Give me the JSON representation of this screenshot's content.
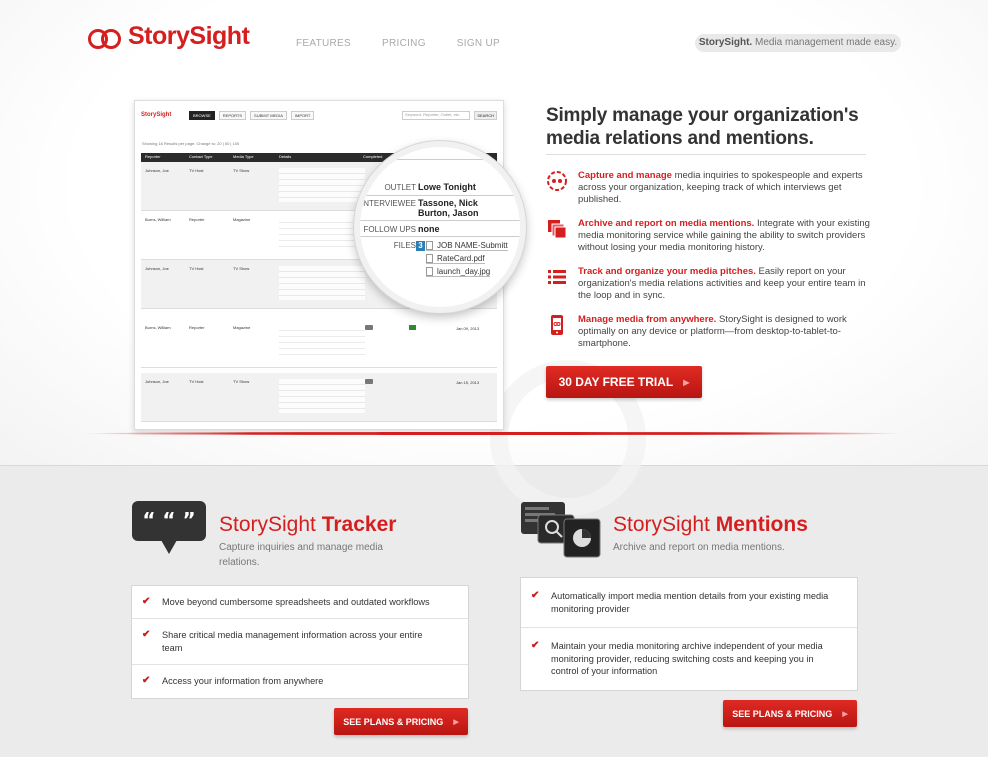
{
  "brand": {
    "name": "StorySight",
    "color": "#d51f1f"
  },
  "nav": {
    "items": [
      "Features",
      "Pricing",
      "Sign Up"
    ]
  },
  "tagline": {
    "bold": "StorySight.",
    "text": " Media management made easy."
  },
  "app_preview": {
    "logo": "StorySight",
    "buttons": [
      "BROWSE",
      "REPORTS",
      "SUBMIT MEDIA",
      "IMPORT"
    ],
    "search_placeholder": "Keyword, Reporter, Outlet, etc.",
    "search_button": "SEARCH",
    "results_text": "Showing 16 Results per page. Change to: 20 | 50 | 100",
    "columns": [
      "Reporter",
      "Contact Type",
      "Media Type",
      "Details",
      "Completed"
    ],
    "rows": [
      {
        "reporter": "Johnson, Joe",
        "contact": "TV Host",
        "media": "TV Show",
        "date": ""
      },
      {
        "reporter": "Burns, William",
        "contact": "Reporter",
        "media": "Magazine",
        "date": ""
      },
      {
        "reporter": "Johnson, Joe",
        "contact": "TV Host",
        "media": "TV Show",
        "date": ""
      },
      {
        "reporter": "Burns, William",
        "contact": "Reporter",
        "media": "Magazine",
        "date": "Jan 09, 2013"
      },
      {
        "reporter": "Johnson, Joe",
        "contact": "TV Host",
        "media": "TV Show",
        "date": "Jan 15, 2013"
      }
    ],
    "lens": {
      "outlet_label": "OUTLET",
      "outlet_value": "Lowe Tonight",
      "interviewee_label": "INTERVIEWEE",
      "interviewee_value_1": "Tassone, Nick",
      "interviewee_value_2": "Burton, Jason",
      "followups_label": "FOLLOW UPS",
      "followups_value": "none",
      "files_label": "FILES",
      "files_count": "3",
      "files": [
        "JOB NAME-Submitt",
        "RateCard.pdf",
        "launch_day.jpg"
      ]
    }
  },
  "hero": {
    "headline": "Simply manage your organization's media relations and mentions.",
    "features": [
      {
        "icon": "quote-circle-icon",
        "title": "Capture and manage",
        "text": " media inquiries to spokespeople and experts across your organization, keeping track of which interviews get published."
      },
      {
        "icon": "copy-pages-icon",
        "title": "Archive and report on media mentions.",
        "text": " Integrate with your existing media monitoring service while gaining the ability to switch providers without losing your media monitoring history."
      },
      {
        "icon": "list-icon",
        "title": "Track and organize your media pitches.",
        "text": " Easily report on your organization's media relations activities and keep your entire team in the loop and in sync."
      },
      {
        "icon": "smartphone-icon",
        "title": "Manage media from anywhere.",
        "text": " StorySight is designed to work optimally on any device or platform—from desktop-to-tablet-to-smartphone."
      }
    ],
    "cta": "30 DAY FREE TRIAL"
  },
  "products": [
    {
      "icon": "speech-bubble-icon",
      "title_prefix": "StorySight ",
      "title_bold": "Tracker",
      "subtitle": "Capture inquiries and manage media relations.",
      "items": [
        "Move beyond cumbersome spreadsheets and outdated workflows",
        "Share critical media management information across your entire team",
        "Access your information from anywhere"
      ],
      "button": "SEE PLANS & PRICING"
    },
    {
      "icon": "monitors-icon",
      "title_prefix": "StorySight ",
      "title_bold": "Mentions",
      "subtitle": "Archive and report on media mentions.",
      "items": [
        "Automatically import media mention details from your existing media monitoring provider",
        "Maintain your media monitoring archive independent of your media monitoring provider, reducing switching costs and keeping you in control of your information"
      ],
      "button": "SEE PLANS & PRICING"
    }
  ]
}
